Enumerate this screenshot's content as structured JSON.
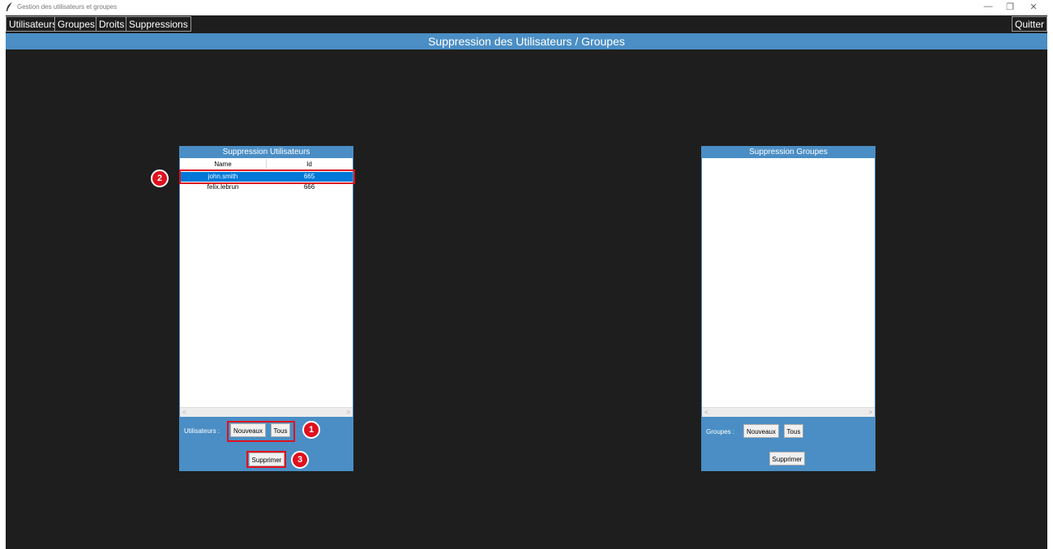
{
  "window": {
    "title": "Gestion des utilisateurs et groupes",
    "controls": {
      "minimize": "—",
      "maximize": "❐",
      "close": "✕"
    }
  },
  "menu": {
    "items": [
      "Utilisateurs",
      "Groupes",
      "Droits",
      "Suppressions"
    ],
    "quit": "Quitter"
  },
  "header": "Suppression des Utilisateurs / Groupes",
  "users_panel": {
    "title": "Suppression Utilisateurs",
    "columns": [
      "Name",
      "Id"
    ],
    "rows": [
      {
        "name": "john.smith",
        "id": "665",
        "selected": true
      },
      {
        "name": "felix.lebrun",
        "id": "666",
        "selected": false
      }
    ],
    "filter_label": "Utilisateurs :",
    "btn_new": "Nouveaux",
    "btn_all": "Tous",
    "btn_delete": "Supprimer"
  },
  "groups_panel": {
    "title": "Suppression Groupes",
    "filter_label": "Groupes :",
    "btn_new": "Nouveaux",
    "btn_all": "Tous",
    "btn_delete": "Supprimer"
  },
  "annotations": [
    "1",
    "2",
    "3"
  ],
  "colors": {
    "background": "#1e1e1e",
    "accent": "#4a8ec5",
    "selection": "#0078d7",
    "annotation": "#e0101e"
  }
}
